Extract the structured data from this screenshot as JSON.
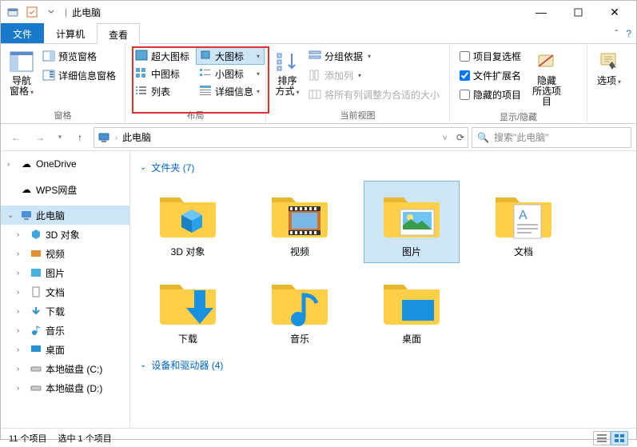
{
  "title": "此电脑",
  "tabs": {
    "file": "文件",
    "computer": "计算机",
    "view": "查看"
  },
  "ribbon": {
    "panes": {
      "nav_pane": "导航窗格",
      "preview_pane": "预览窗格",
      "details_pane": "详细信息窗格",
      "group_label": "窗格"
    },
    "layout": {
      "extra_large": "超大图标",
      "large": "大图标",
      "medium": "中图标",
      "small": "小图标",
      "list": "列表",
      "details": "详细信息",
      "group_label": "布局"
    },
    "current_view": {
      "sort_by": "排序方式",
      "group_by": "分组依据",
      "add_columns": "添加列",
      "fit_columns": "将所有列调整为合适的大小",
      "group_label": "当前视图"
    },
    "show_hide": {
      "item_checkboxes": "项目复选框",
      "file_ext": "文件扩展名",
      "hidden_items": "隐藏的项目",
      "hide_selected": "隐藏\n所选项目",
      "group_label": "显示/隐藏"
    },
    "options": "选项"
  },
  "address": {
    "location": "此电脑"
  },
  "search": {
    "placeholder": "搜索\"此电脑\""
  },
  "sidebar": {
    "onedrive": "OneDrive",
    "wps": "WPS网盘",
    "this_pc": "此电脑",
    "children": {
      "3d": "3D 对象",
      "videos": "视频",
      "pictures": "图片",
      "documents": "文档",
      "downloads": "下载",
      "music": "音乐",
      "desktop": "桌面",
      "disk_c": "本地磁盘 (C:)",
      "disk_d": "本地磁盘 (D:)"
    }
  },
  "content": {
    "folders_header": "文件夹 (7)",
    "drives_header": "设备和驱动器 (4)",
    "items": {
      "3d": "3D 对象",
      "videos": "视频",
      "pictures": "图片",
      "documents": "文档",
      "downloads": "下载",
      "music": "音乐",
      "desktop": "桌面"
    }
  },
  "status": {
    "count": "11 个项目",
    "selected": "选中 1 个项目"
  }
}
